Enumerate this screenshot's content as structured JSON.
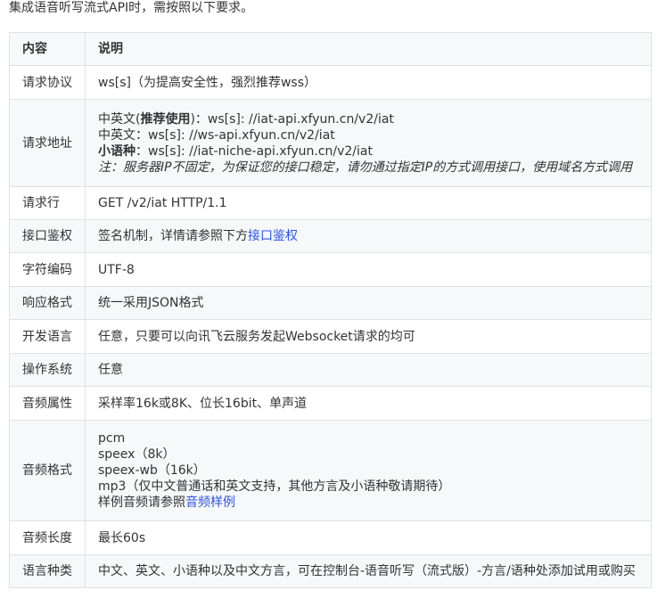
{
  "intro": "集成语音听写流式API时，需按照以下要求。",
  "table": {
    "headers": [
      "内容",
      "说明"
    ],
    "rows": {
      "protocol": {
        "label": "请求协议",
        "value": "ws[s]（为提高安全性，强烈推荐wss）"
      },
      "address": {
        "label": "请求地址",
        "line1_prefix": "中英文(",
        "line1_bold": "推荐使用",
        "line1_suffix": ")：ws[s]: //iat-api.xfyun.cn/v2/iat",
        "line2": "中英文：ws[s]: //ws-api.xfyun.cn/v2/iat",
        "line3_bold": "小语种",
        "line3_suffix": "：ws[s]: //iat-niche-api.xfyun.cn/v2/iat",
        "note": "注：服务器IP不固定，为保证您的接口稳定，请勿通过指定IP的方式调用接口，使用域名方式调用"
      },
      "request_line": {
        "label": "请求行",
        "value": "GET /v2/iat HTTP/1.1"
      },
      "auth": {
        "label": "接口鉴权",
        "value_prefix": "签名机制，详情请参照下方",
        "link": "接口鉴权"
      },
      "encoding": {
        "label": "字符编码",
        "value": "UTF-8"
      },
      "response": {
        "label": "响应格式",
        "value": "统一采用JSON格式"
      },
      "language": {
        "label": "开发语言",
        "value": "任意，只要可以向讯飞云服务发起Websocket请求的均可"
      },
      "os": {
        "label": "操作系统",
        "value": "任意"
      },
      "audio_props": {
        "label": "音频属性",
        "value": "采样率16k或8K、位长16bit、单声道"
      },
      "audio_format": {
        "label": "音频格式",
        "lines": [
          "pcm",
          "speex（8k）",
          "speex-wb（16k）",
          "mp3（仅中文普通话和英文支持，其他方言及小语种敬请期待）"
        ],
        "sample_prefix": "样例音频请参照",
        "sample_link": "音频样例"
      },
      "audio_length": {
        "label": "音频长度",
        "value": "最长60s"
      },
      "lang_types": {
        "label": "语言种类",
        "value": "中文、英文、小语种以及中文方言，可在控制台-语音听写（流式版）-方言/语种处添加试用或购买"
      }
    }
  },
  "colors": {
    "link": "#2c55e6",
    "border": "#dfe2e5",
    "alt_row": "#f6f8fa"
  }
}
